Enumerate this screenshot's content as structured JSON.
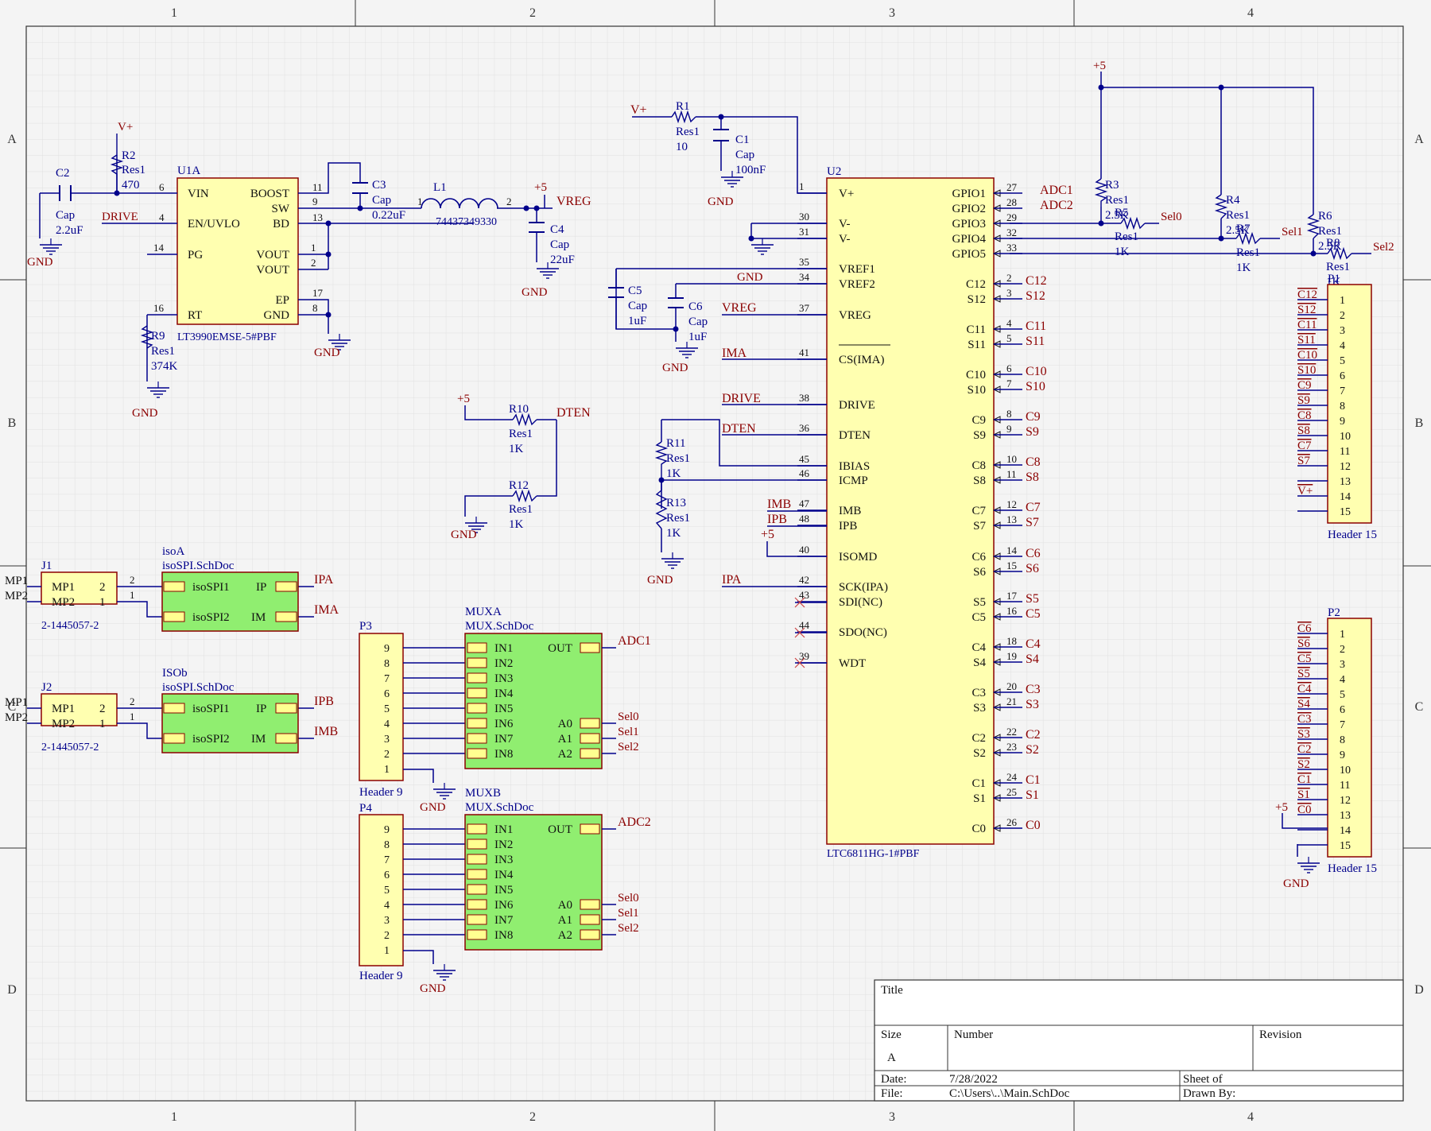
{
  "border": {
    "cols": [
      "1",
      "2",
      "3",
      "4"
    ],
    "rows": [
      "A",
      "B",
      "C",
      "D"
    ]
  },
  "u1a": {
    "designator": "U1A",
    "part": "LT3990EMSE-5#PBF",
    "pins_left": [
      {
        "name": "VIN",
        "num": "6"
      },
      {
        "name": "EN/UVLO",
        "num": "4"
      },
      {
        "name": "PG",
        "num": "14"
      },
      {
        "name": "RT",
        "num": "16"
      }
    ],
    "pins_right": [
      {
        "name": "BOOST",
        "num": "11"
      },
      {
        "name": "SW",
        "num": "9"
      },
      {
        "name": "BD",
        "num": "13"
      },
      {
        "name": "VOUT",
        "num": "1"
      },
      {
        "name": "VOUT",
        "num": "2"
      },
      {
        "name": "EP",
        "num": "17"
      },
      {
        "name": "GND",
        "num": "8"
      }
    ]
  },
  "u2": {
    "designator": "U2",
    "part": "LTC6811HG-1#PBF",
    "pins_left": [
      {
        "name": "V+",
        "num": "1"
      },
      {
        "name": "V-",
        "num": "30"
      },
      {
        "name": "V-",
        "num": "31"
      },
      {
        "name": "VREF1",
        "num": "35"
      },
      {
        "name": "VREF2",
        "num": "34"
      },
      {
        "name": "VREG",
        "num": "37"
      },
      {
        "name": "CS(IMA)",
        "num": "41"
      },
      {
        "name": "DRIVE",
        "num": "38"
      },
      {
        "name": "DTEN",
        "num": "36"
      },
      {
        "name": "IBIAS",
        "num": "45"
      },
      {
        "name": "ICMP",
        "num": "46"
      },
      {
        "name": "IMB",
        "num": "47"
      },
      {
        "name": "IPB",
        "num": "48"
      },
      {
        "name": "ISOMD",
        "num": "40"
      },
      {
        "name": "SCK(IPA)",
        "num": "42"
      },
      {
        "name": "SDI(NC)",
        "num": "43"
      },
      {
        "name": "SDO(NC)",
        "num": "44"
      },
      {
        "name": "WDT",
        "num": "39"
      }
    ],
    "pins_right": [
      {
        "name": "GPIO1",
        "num": "27",
        "net": "ADC1"
      },
      {
        "name": "GPIO2",
        "num": "28",
        "net": "ADC2"
      },
      {
        "name": "GPIO3",
        "num": "29",
        "net": ""
      },
      {
        "name": "GPIO4",
        "num": "32",
        "net": ""
      },
      {
        "name": "GPIO5",
        "num": "33",
        "net": ""
      },
      {
        "name": "C12",
        "num": "2",
        "net": "C12"
      },
      {
        "name": "S12",
        "num": "3",
        "net": "S12"
      },
      {
        "name": "C11",
        "num": "4",
        "net": "C11"
      },
      {
        "name": "S11",
        "num": "5",
        "net": "S11"
      },
      {
        "name": "C10",
        "num": "6",
        "net": "C10"
      },
      {
        "name": "S10",
        "num": "7",
        "net": "S10"
      },
      {
        "name": "C9",
        "num": "8",
        "net": "C9"
      },
      {
        "name": "S9",
        "num": "9",
        "net": "S9"
      },
      {
        "name": "C8",
        "num": "10",
        "net": "C8"
      },
      {
        "name": "S8",
        "num": "11",
        "net": "S8"
      },
      {
        "name": "C7",
        "num": "12",
        "net": "C7"
      },
      {
        "name": "S7",
        "num": "13",
        "net": "S7"
      },
      {
        "name": "C6",
        "num": "14",
        "net": "C6"
      },
      {
        "name": "S6",
        "num": "15",
        "net": "S6"
      },
      {
        "name": "S5",
        "num": "17",
        "net": "S5"
      },
      {
        "name": "C5",
        "num": "16",
        "net": "C5"
      },
      {
        "name": "C4",
        "num": "18",
        "net": "C4"
      },
      {
        "name": "S4",
        "num": "19",
        "net": "S4"
      },
      {
        "name": "C3",
        "num": "20",
        "net": "C3"
      },
      {
        "name": "S3",
        "num": "21",
        "net": "S3"
      },
      {
        "name": "C2",
        "num": "22",
        "net": "C2"
      },
      {
        "name": "S2",
        "num": "23",
        "net": "S2"
      },
      {
        "name": "C1",
        "num": "24",
        "net": "C1"
      },
      {
        "name": "S1",
        "num": "25",
        "net": "S1"
      },
      {
        "name": "C0",
        "num": "26",
        "net": "C0"
      }
    ]
  },
  "components": {
    "c2": {
      "ref": "C2",
      "type": "Cap",
      "value": "2.2uF"
    },
    "r2": {
      "ref": "R2",
      "type": "Res1",
      "value": "470"
    },
    "c3": {
      "ref": "C3",
      "type": "Cap",
      "value": "0.22uF"
    },
    "l1": {
      "ref": "L1",
      "value": "74437349330",
      "pin1": "1",
      "pin2": "2"
    },
    "c4": {
      "ref": "C4",
      "type": "Cap",
      "value": "22uF"
    },
    "r9": {
      "ref": "R9",
      "type": "Res1",
      "value": "374K"
    },
    "r1": {
      "ref": "R1",
      "type": "Res1",
      "value": "10"
    },
    "c1": {
      "ref": "C1",
      "type": "Cap",
      "value": "100nF"
    },
    "c5": {
      "ref": "C5",
      "type": "Cap",
      "value": "1uF"
    },
    "c6": {
      "ref": "C6",
      "type": "Cap",
      "value": "1uF"
    },
    "r10": {
      "ref": "R10",
      "type": "Res1",
      "value": "1K"
    },
    "r12": {
      "ref": "R12",
      "type": "Res1",
      "value": "1K"
    },
    "r11": {
      "ref": "R11",
      "type": "Res1",
      "value": "1K"
    },
    "r13": {
      "ref": "R13",
      "type": "Res1",
      "value": "1K"
    },
    "r3": {
      "ref": "R3",
      "type": "Res1",
      "value": "2.5K"
    },
    "r4": {
      "ref": "R4",
      "type": "Res1",
      "value": "2.5K"
    },
    "r5": {
      "ref": "R5",
      "type": "Res1",
      "value": "1K"
    },
    "r6": {
      "ref": "R6",
      "type": "Res1",
      "value": "2.5K"
    },
    "r7": {
      "ref": "R7",
      "type": "Res1",
      "value": "1K"
    },
    "r8": {
      "ref": "R8",
      "type": "Res1",
      "value": "1K"
    }
  },
  "power": {
    "vplus": "V+",
    "gnd": "GND",
    "p5": "+5",
    "vreg": "VREG"
  },
  "nets": {
    "drive": "DRIVE",
    "dten": "DTEN",
    "ima": "IMA",
    "imb": "IMB",
    "ipb": "IPB",
    "ipa": "IPA",
    "adc1": "ADC1",
    "adc2": "ADC2",
    "sel0": "Sel0",
    "sel1": "Sel1",
    "sel2": "Sel2",
    "mp1": "MP1",
    "mp2": "MP2"
  },
  "j1": {
    "ref": "J1",
    "part": "2-1445057-2",
    "pins": [
      {
        "name": "MP1",
        "num": "2"
      },
      {
        "name": "MP2",
        "num": "1"
      }
    ]
  },
  "j2": {
    "ref": "J2",
    "part": "2-1445057-2",
    "pins": [
      {
        "name": "MP1",
        "num": "2"
      },
      {
        "name": "MP2",
        "num": "1"
      }
    ]
  },
  "isoa": {
    "ref": "isoA",
    "file": "isoSPI.SchDoc",
    "ports": [
      "isoSPI1",
      "isoSPI2",
      "IP",
      "IM"
    ],
    "pins": [
      "2",
      "1"
    ]
  },
  "isob": {
    "ref": "ISOb",
    "file": "isoSPI.SchDoc",
    "ports": [
      "isoSPI1",
      "isoSPI2",
      "IP",
      "IM"
    ],
    "pins": [
      "2",
      "1"
    ]
  },
  "muxa": {
    "ref": "MUXA",
    "file": "MUX.SchDoc",
    "inputs": [
      "IN1",
      "IN2",
      "IN3",
      "IN4",
      "IN5",
      "IN6",
      "IN7",
      "IN8"
    ],
    "out": "OUT",
    "sel": [
      "A0",
      "A1",
      "A2"
    ]
  },
  "muxb": {
    "ref": "MUXB",
    "file": "MUX.SchDoc",
    "inputs": [
      "IN1",
      "IN2",
      "IN3",
      "IN4",
      "IN5",
      "IN6",
      "IN7",
      "IN8"
    ],
    "out": "OUT",
    "sel": [
      "A0",
      "A1",
      "A2"
    ]
  },
  "p3": {
    "ref": "P3",
    "part": "Header 9",
    "pins": [
      "9",
      "8",
      "7",
      "6",
      "5",
      "4",
      "3",
      "2",
      "1"
    ]
  },
  "p4": {
    "ref": "P4",
    "part": "Header 9",
    "pins": [
      "9",
      "8",
      "7",
      "6",
      "5",
      "4",
      "3",
      "2",
      "1"
    ]
  },
  "p1": {
    "ref": "P1",
    "part": "Header 15",
    "pins": [
      "1",
      "2",
      "3",
      "4",
      "5",
      "6",
      "7",
      "8",
      "9",
      "10",
      "11",
      "12",
      "13",
      "14",
      "15"
    ],
    "nets": [
      "C12",
      "S12",
      "C11",
      "S11",
      "C10",
      "S10",
      "C9",
      "S9",
      "C8",
      "S8",
      "C7",
      "S7",
      "",
      "V+",
      ""
    ]
  },
  "p2": {
    "ref": "P2",
    "part": "Header 15",
    "pins": [
      "1",
      "2",
      "3",
      "4",
      "5",
      "6",
      "7",
      "8",
      "9",
      "10",
      "11",
      "12",
      "13",
      "14",
      "15"
    ],
    "nets": [
      "C6",
      "S6",
      "C5",
      "S5",
      "C4",
      "S4",
      "C3",
      "S3",
      "C2",
      "S2",
      "C1",
      "S1",
      "C0",
      "",
      ""
    ]
  },
  "title_block": {
    "title_label": "Title",
    "size_label": "Size",
    "size_value": "A",
    "number_label": "Number",
    "revision_label": "Revision",
    "date_label": "Date:",
    "date_value": "7/28/2022",
    "sheet_label": "Sheet  of",
    "file_label": "File:",
    "file_value": "C:\\Users\\..\\Main.SchDoc",
    "drawn_label": "Drawn By:"
  }
}
